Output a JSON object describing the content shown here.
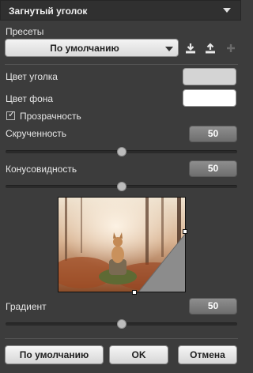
{
  "panel": {
    "title": "Загнутый уголок"
  },
  "presets": {
    "label": "Пресеты",
    "selected": "По умолчанию",
    "icons": [
      "save-preset-icon",
      "upload-preset-icon",
      "add-preset-icon"
    ]
  },
  "corner_color": {
    "label": "Цвет уголка",
    "color": "#d4d4d4"
  },
  "background_color": {
    "label": "Цвет фона",
    "color": "#ffffff"
  },
  "transparency": {
    "label": "Прозрачность",
    "checked": true
  },
  "curl": {
    "label": "Скрученность",
    "value": "50",
    "fraction": 0.5
  },
  "taper": {
    "label": "Конусовидность",
    "value": "50",
    "fraction": 0.5
  },
  "gradient": {
    "label": "Градиент",
    "value": "50",
    "fraction": 0.5
  },
  "buttons": {
    "default_label": "По умолчанию",
    "ok_label": "OK",
    "cancel_label": "Отмена"
  }
}
